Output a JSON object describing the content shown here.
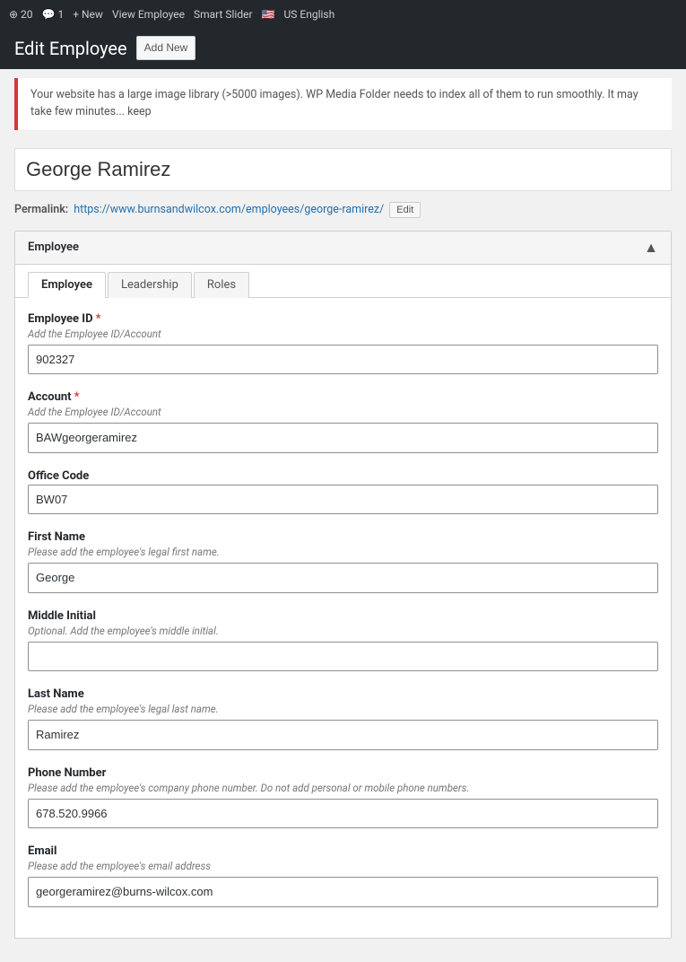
{
  "adminBar": {
    "items": [
      "20",
      "1",
      "New",
      "View Employee",
      "Smart Slider",
      "US English"
    ]
  },
  "pageHeader": {
    "title": "Edit Employee",
    "addNewLabel": "Add New"
  },
  "notice": {
    "text": "Your website has a large image library (>5000 images). WP Media Folder needs to index all of them to run smoothly. It may take few minutes... keep"
  },
  "postTitle": {
    "value": "George Ramirez"
  },
  "permalink": {
    "label": "Permalink:",
    "url": "https://www.burnsandwilcox.com/employees/george-ramirez/",
    "editLabel": "Edit"
  },
  "metaBox": {
    "title": "Employee",
    "toggleIcon": "▲"
  },
  "tabs": [
    {
      "id": "employee",
      "label": "Employee",
      "active": true
    },
    {
      "id": "leadership",
      "label": "Leadership",
      "active": false
    },
    {
      "id": "roles",
      "label": "Roles",
      "active": false
    }
  ],
  "fields": {
    "employeeId": {
      "label": "Employee ID",
      "required": true,
      "hint": "Add the Employee ID/Account",
      "value": "902327"
    },
    "account": {
      "label": "Account",
      "required": true,
      "hint": "Add the Employee ID/Account",
      "value": "BAWgeorgeramirez"
    },
    "officeCode": {
      "label": "Office Code",
      "required": false,
      "hint": "",
      "value": "BW07"
    },
    "firstName": {
      "label": "First Name",
      "required": false,
      "hint": "Please add the employee's legal first name.",
      "value": "George"
    },
    "middleInitial": {
      "label": "Middle Initial",
      "required": false,
      "hint": "Optional. Add the employee's middle initial.",
      "value": ""
    },
    "lastName": {
      "label": "Last Name",
      "required": false,
      "hint": "Please add the employee's legal last name.",
      "value": "Ramirez"
    },
    "phoneNumber": {
      "label": "Phone Number",
      "required": false,
      "hint": "Please add the employee's company phone number. Do not add personal or mobile phone numbers.",
      "value": "678.520.9966"
    },
    "email": {
      "label": "Email",
      "required": false,
      "hint": "Please add the employee's email address",
      "value": "georgeramirez@burns-wilcox.com"
    }
  }
}
